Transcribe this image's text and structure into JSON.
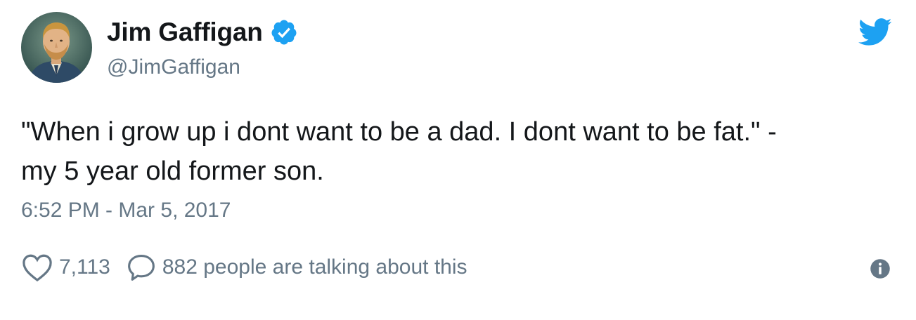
{
  "author": {
    "display_name": "Jim Gaffigan",
    "handle": "@JimGaffigan",
    "verified": true,
    "avatar_icon": "portrait-avatar"
  },
  "tweet": {
    "text_line_1": "\"When i grow up i dont want to be a dad.  I dont want to be fat.\" -",
    "text_line_2": "my 5 year old former son.",
    "timestamp": "6:52 PM - Mar 5, 2017"
  },
  "actions": {
    "like_icon": "heart-icon",
    "like_count": "7,113",
    "reply_icon": "speech-bubble-icon",
    "talking_text": "882 people are talking about this",
    "info_icon": "info-icon"
  },
  "colors": {
    "brand_blue": "#1da1f2",
    "text_primary": "#14171a",
    "text_secondary": "#657786"
  }
}
